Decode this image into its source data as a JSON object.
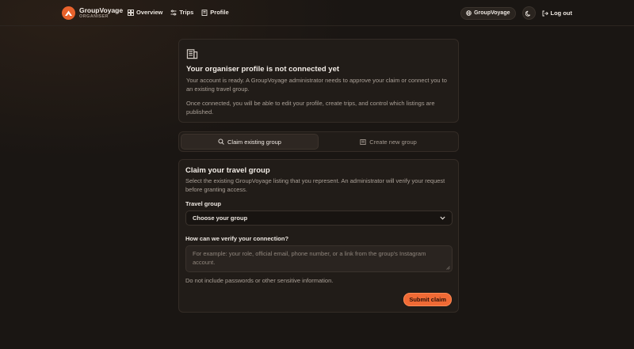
{
  "header": {
    "brand_name": "GroupVoyage",
    "brand_sub": "ORGANISER",
    "nav": [
      {
        "label": "Overview",
        "icon": "grid-icon"
      },
      {
        "label": "Trips",
        "icon": "sliders-icon"
      },
      {
        "label": "Profile",
        "icon": "building-icon"
      }
    ],
    "account_label": "GroupVoyage",
    "logout_label": "Log out"
  },
  "notice": {
    "icon": "building-icon",
    "title": "Your organiser profile is not connected yet",
    "body1": "Your account is ready. A GroupVoyage administrator needs to approve your claim or connect you to an existing travel group.",
    "body2": "Once connected, you will be able to edit your profile, create trips, and control which listings are published."
  },
  "tabs": [
    {
      "label": "Claim existing group",
      "icon": "search-icon",
      "active": true
    },
    {
      "label": "Create new group",
      "icon": "building-icon",
      "active": false
    }
  ],
  "form": {
    "title": "Claim your travel group",
    "description": "Select the existing GroupVoyage listing that you represent. An administrator will verify your request before granting access.",
    "group_label": "Travel group",
    "group_value": "Choose your group",
    "verify_label": "How can we verify your connection?",
    "verify_placeholder": "For example: your role, official email, phone number, or a link from the group's Instagram account.",
    "hint": "Do not include passwords or other sensitive information.",
    "submit_label": "Submit claim"
  },
  "colors": {
    "accent": "#f06a35",
    "background": "#1a1613",
    "card": "#211c18"
  }
}
